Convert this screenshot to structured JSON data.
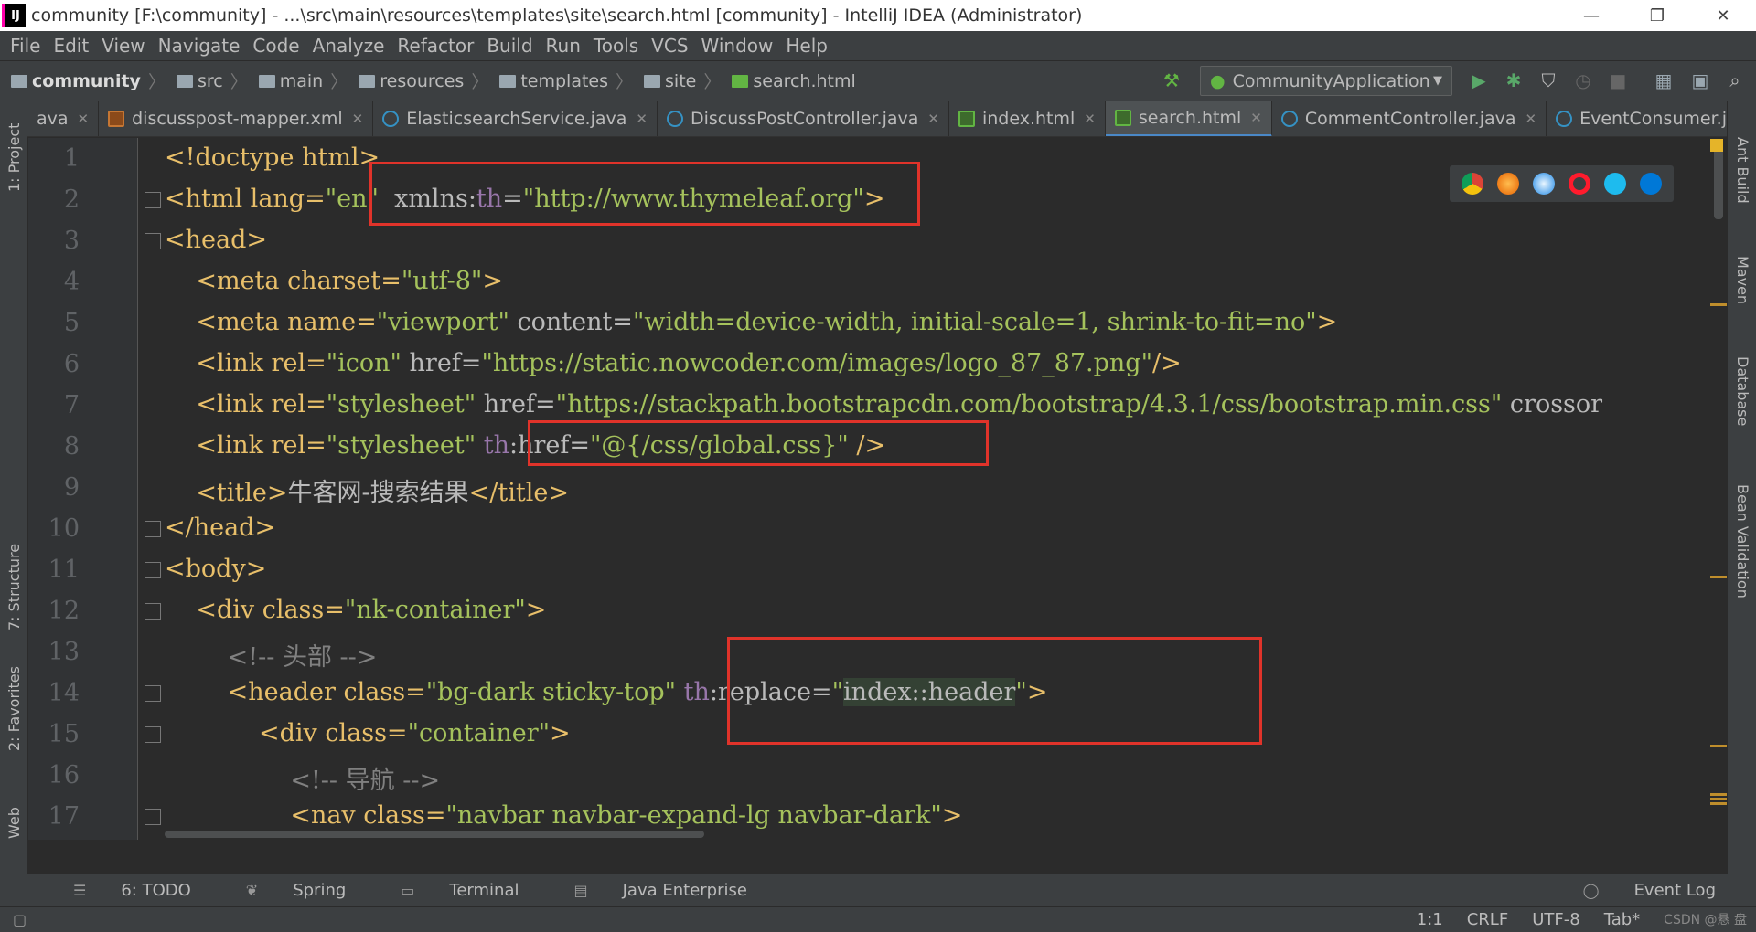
{
  "window": {
    "title": "community [F:\\community] - ...\\src\\main\\resources\\templates\\site\\search.html [community] - IntelliJ IDEA (Administrator)",
    "app_icon": "IJ",
    "controls": [
      "—",
      "❐",
      "✕"
    ]
  },
  "menu": [
    "File",
    "Edit",
    "View",
    "Navigate",
    "Code",
    "Analyze",
    "Refactor",
    "Build",
    "Run",
    "Tools",
    "VCS",
    "Window",
    "Help"
  ],
  "breadcrumbs": [
    "community",
    "src",
    "main",
    "resources",
    "templates",
    "site",
    "search.html"
  ],
  "run_config": "CommunityApplication",
  "tabs": [
    {
      "label": "ava",
      "type": "java",
      "active": false
    },
    {
      "label": "discusspost-mapper.xml",
      "type": "xml",
      "active": false
    },
    {
      "label": "ElasticsearchService.java",
      "type": "java",
      "active": false
    },
    {
      "label": "DiscussPostController.java",
      "type": "java",
      "active": false
    },
    {
      "label": "index.html",
      "type": "html",
      "active": false
    },
    {
      "label": "search.html",
      "type": "html",
      "active": true
    },
    {
      "label": "CommentController.java",
      "type": "java",
      "active": false
    },
    {
      "label": "EventConsumer.java",
      "type": "java",
      "active": false
    }
  ],
  "tab_overflow": "3",
  "left_tools": [
    "1: Project",
    "7: Structure",
    "2: Favorites",
    "Web"
  ],
  "right_tools": [
    "Ant Build",
    "Maven",
    "Database",
    "Bean Validation"
  ],
  "line_numbers": [
    "1",
    "2",
    "3",
    "4",
    "5",
    "6",
    "7",
    "8",
    "9",
    "10",
    "11",
    "12",
    "13",
    "14",
    "15",
    "16",
    "17"
  ],
  "code": {
    "l1": "<!doctype html>",
    "l2a": "<html lang=",
    "l2b": "\"en\"",
    "l2c": "  xmlns:",
    "l2d": "th",
    "l2e": "=",
    "l2f": "\"http://www.thymeleaf.org\"",
    "l2g": ">",
    "l3": "<head>",
    "l4a": "    <meta charset=",
    "l4b": "\"utf-8\"",
    "l4c": ">",
    "l5a": "    <meta name=",
    "l5b": "\"viewport\"",
    "l5c": " content=",
    "l5d": "\"width=device-width, initial-scale=1, shrink-to-fit=no\"",
    "l5e": ">",
    "l6a": "    <link rel=",
    "l6b": "\"icon\"",
    "l6c": " href=",
    "l6d": "\"https://static.nowcoder.com/images/logo_87_87.png\"",
    "l6e": "/>",
    "l7a": "    <link rel=",
    "l7b": "\"stylesheet\"",
    "l7c": " href=",
    "l7d": "\"https://stackpath.bootstrapcdn.com/bootstrap/4.3.1/css/bootstrap.min.css\"",
    "l7e": " crossor",
    "l8a": "    <link rel=",
    "l8b": "\"stylesheet\"",
    "l8c": " th",
    "l8d": ":href=",
    "l8e": "\"@{/css/global.css}\"",
    "l8f": " />",
    "l9a": "    <title>",
    "l9b": "牛客网-搜索结果",
    "l9c": "</title>",
    "l10": "</head>",
    "l11": "<body>",
    "l12a": "    <div class=",
    "l12b": "\"nk-container\"",
    "l12c": ">",
    "l13": "        <!-- 头部 -->",
    "l14a": "        <header class=",
    "l14b": "\"bg-dark sticky-top\"",
    "l14c": " th",
    "l14d": ":replace=",
    "l14e": "\"",
    "l14f": "index::header",
    "l14g": "\"",
    "l14h": ">",
    "l15a": "            <div class=",
    "l15b": "\"container\"",
    "l15c": ">",
    "l16": "                <!-- 导航 -->",
    "l17a": "                <nav class=",
    "l17b": "\"navbar navbar-expand-lg navbar-dark\"",
    "l17c": ">"
  },
  "tool_windows": [
    "6: TODO",
    "Spring",
    "Terminal",
    "Java Enterprise"
  ],
  "event_log": "Event Log",
  "status": {
    "position": "1:1",
    "line_sep": "CRLF",
    "encoding": "UTF-8",
    "indent": "Tab*",
    "watermark": "CSDN @悬 盘"
  },
  "colors": {
    "red_box": "#e0332a",
    "tag": "#e8bf6a",
    "value": "#a5c25c",
    "namespace": "#9876aa"
  }
}
